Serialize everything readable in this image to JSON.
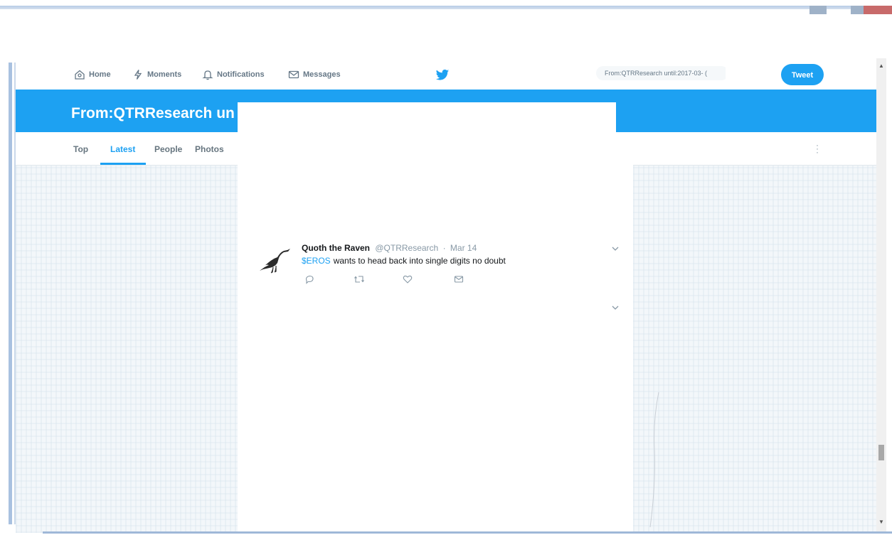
{
  "nav": {
    "home_label": "Home",
    "moments_label": "Moments",
    "notifications_label": "Notifications",
    "messages_label": "Messages",
    "search_value": "From:QTRResearch until:2017-03- (",
    "tweet_button_label": "Tweet"
  },
  "page": {
    "title": "From:QTRResearch un"
  },
  "tabs": {
    "top": "Top",
    "latest": "Latest",
    "people": "People",
    "photos": "Photos"
  },
  "tweet": {
    "author": "Quoth the Raven",
    "handle": "@QTRResearch",
    "separator": "·",
    "time": "Mar 14",
    "cashtag": "$EROS",
    "text": "wants to head back into single digits no doubt"
  },
  "colors": {
    "brand_blue": "#1da1f2",
    "banner_text": "#ffffff",
    "muted": "#8899a6"
  },
  "icons": {
    "home": "home-icon",
    "moments": "lightning-icon",
    "notifications": "bell-icon",
    "messages": "envelope-icon",
    "logo": "twitter-bird-icon",
    "reply": "reply-icon",
    "retweet": "retweet-icon",
    "like": "heart-icon",
    "dm": "direct-message-icon"
  }
}
